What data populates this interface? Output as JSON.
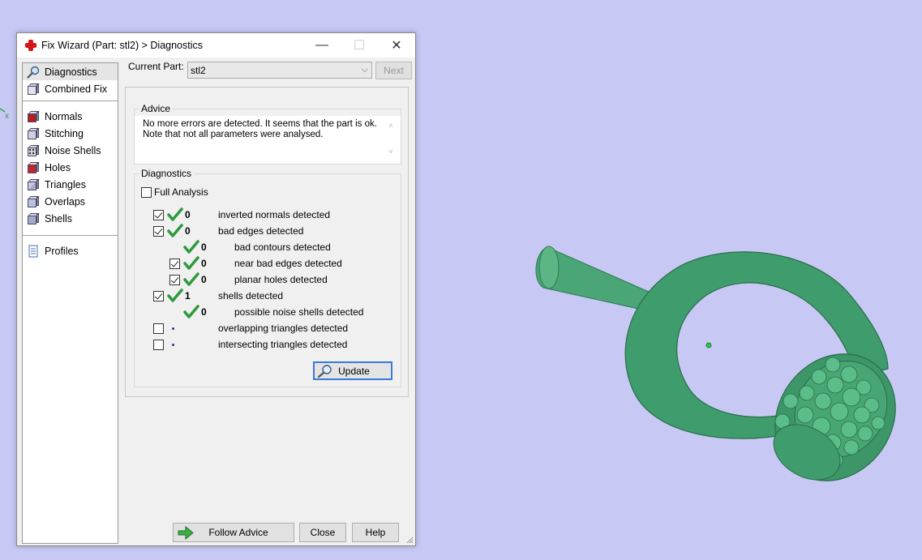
{
  "window": {
    "title": "Fix Wizard (Part: stl2) > Diagnostics",
    "minimize": "—",
    "maximize": "☐",
    "close": "✕"
  },
  "viewport": {
    "axis_label": "x",
    "model_color": "#3f9c6c",
    "background": "#c7c8f4"
  },
  "nav": {
    "top_items": [
      {
        "label": "Diagnostics",
        "icon": "magnifier-icon",
        "selected": true
      },
      {
        "label": "Combined Fix",
        "icon": "cube-icon"
      }
    ],
    "fix_items": [
      {
        "label": "Normals",
        "icon": "normals-cube-icon"
      },
      {
        "label": "Stitching",
        "icon": "stitching-cube-icon"
      },
      {
        "label": "Noise Shells",
        "icon": "noise-shells-icon"
      },
      {
        "label": "Holes",
        "icon": "holes-cube-icon"
      },
      {
        "label": "Triangles",
        "icon": "triangles-cube-icon"
      },
      {
        "label": "Overlaps",
        "icon": "overlaps-cube-icon"
      },
      {
        "label": "Shells",
        "icon": "shells-cube-icon"
      }
    ],
    "bottom_items": [
      {
        "label": "Profiles",
        "icon": "document-icon"
      }
    ]
  },
  "current_part": {
    "label": "Current Part:",
    "value": "stl2"
  },
  "next_label": "Next",
  "advice": {
    "title": "Advice",
    "text_line1": "No more errors are detected. It seems that the part is ok.",
    "text_line2": "Note that not all parameters were analysed."
  },
  "diagnostics": {
    "title": "Diagnostics",
    "full_analysis_label": "Full Analysis",
    "full_analysis_checked": false,
    "rows": [
      {
        "label": "inverted normals detected",
        "count": "0",
        "checked": true,
        "has_checkbox": true,
        "indent": 0,
        "status": "ok"
      },
      {
        "label": "bad edges detected",
        "count": "0",
        "checked": true,
        "has_checkbox": true,
        "indent": 0,
        "status": "ok"
      },
      {
        "label": "bad contours detected",
        "count": "0",
        "checked": false,
        "has_checkbox": false,
        "indent": 1,
        "status": "ok"
      },
      {
        "label": "near bad edges detected",
        "count": "0",
        "checked": true,
        "has_checkbox": true,
        "indent": 1,
        "status": "ok"
      },
      {
        "label": "planar holes detected",
        "count": "0",
        "checked": true,
        "has_checkbox": true,
        "indent": 1,
        "status": "ok"
      },
      {
        "label": "shells detected",
        "count": "1",
        "checked": true,
        "has_checkbox": true,
        "indent": 0,
        "status": "ok"
      },
      {
        "label": "possible noise shells detected",
        "count": "0",
        "checked": false,
        "has_checkbox": false,
        "indent": 1,
        "status": "ok"
      },
      {
        "label": "overlapping triangles detected",
        "count": "",
        "checked": false,
        "has_checkbox": true,
        "indent": 0,
        "status": "pending"
      },
      {
        "label": "intersecting triangles detected",
        "count": "",
        "checked": false,
        "has_checkbox": true,
        "indent": 0,
        "status": "pending"
      }
    ],
    "update_label": "Update"
  },
  "buttons": {
    "follow_advice": "Follow Advice",
    "close": "Close",
    "help": "Help"
  },
  "colors": {
    "check_green": "#2e9a3e",
    "focus_blue": "#3a7ad8",
    "accent_red": "#d6141b"
  }
}
